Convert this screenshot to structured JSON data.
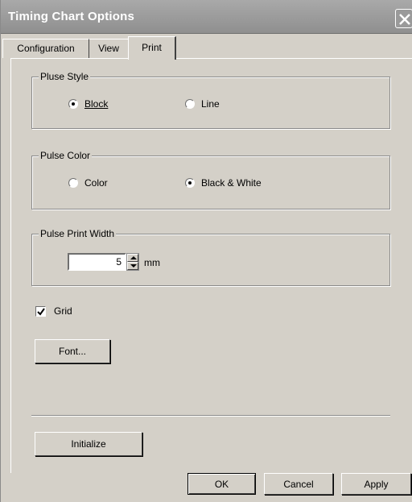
{
  "window": {
    "title": "Timing Chart Options"
  },
  "tabs": [
    {
      "label": "Configuration",
      "active": false
    },
    {
      "label": "View",
      "active": false
    },
    {
      "label": "Print",
      "active": true
    }
  ],
  "pulse_style": {
    "label": "Pluse Style",
    "options": [
      {
        "label": "Block",
        "checked": true
      },
      {
        "label": "Line",
        "checked": false
      }
    ]
  },
  "pulse_color": {
    "label": "Pulse Color",
    "options": [
      {
        "label": "Color",
        "checked": false
      },
      {
        "label": "Black & White",
        "checked": true
      }
    ]
  },
  "pulse_print_width": {
    "label": "Pulse Print Width",
    "value": "5",
    "unit": "mm"
  },
  "grid": {
    "label": "Grid",
    "checked": true
  },
  "buttons": {
    "font": "Font...",
    "initialize": "Initialize",
    "ok": "OK",
    "cancel": "Cancel",
    "apply": "Apply"
  },
  "icons": {
    "close": "close-icon",
    "spin_up": "arrow-up-icon",
    "spin_down": "arrow-down-icon",
    "check": "checkmark-icon"
  }
}
